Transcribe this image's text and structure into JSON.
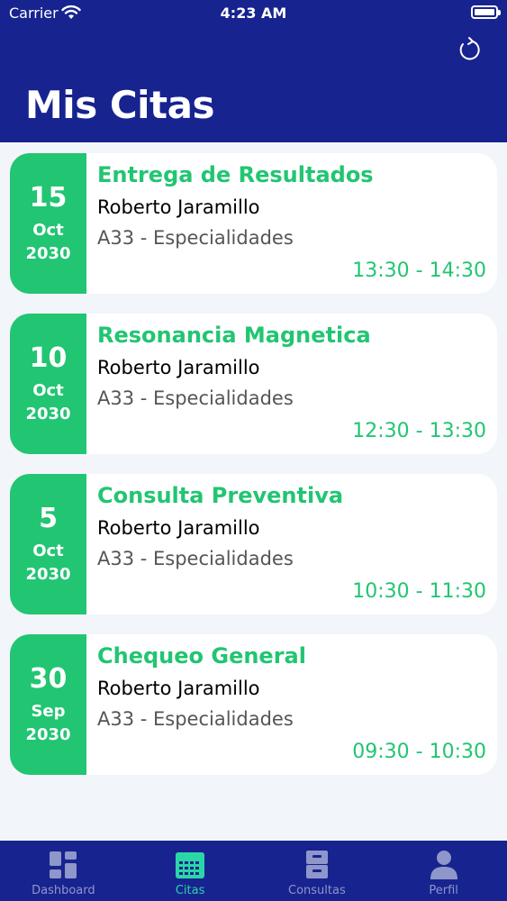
{
  "status_bar": {
    "carrier": "Carrier",
    "time": "4:23 AM"
  },
  "header": {
    "title": "Mis Citas"
  },
  "appointments": [
    {
      "day": "15",
      "month": "Oct",
      "year": "2030",
      "title": "Entrega de Resultados",
      "doctor": "Roberto Jaramillo",
      "location": "A33 - Especialidades",
      "time": "13:30 - 14:30"
    },
    {
      "day": "10",
      "month": "Oct",
      "year": "2030",
      "title": "Resonancia Magnetica",
      "doctor": "Roberto Jaramillo",
      "location": "A33 - Especialidades",
      "time": "12:30 - 13:30"
    },
    {
      "day": "5",
      "month": "Oct",
      "year": "2030",
      "title": "Consulta Preventiva",
      "doctor": "Roberto Jaramillo",
      "location": "A33 - Especialidades",
      "time": "10:30 - 11:30"
    },
    {
      "day": "30",
      "month": "Sep",
      "year": "2030",
      "title": "Chequeo General",
      "doctor": "Roberto Jaramillo",
      "location": "A33 - Especialidades",
      "time": "09:30 - 10:30"
    }
  ],
  "tabs": [
    {
      "label": "Dashboard",
      "icon": "dashboard-icon"
    },
    {
      "label": "Citas",
      "icon": "calendar-icon"
    },
    {
      "label": "Consultas",
      "icon": "cabinet-icon"
    },
    {
      "label": "Perfil",
      "icon": "user-icon"
    }
  ],
  "colors": {
    "primary": "#17238f",
    "accent": "#22c572",
    "tab_active": "#2bd6a6",
    "tab_inactive": "#8f96c9"
  }
}
